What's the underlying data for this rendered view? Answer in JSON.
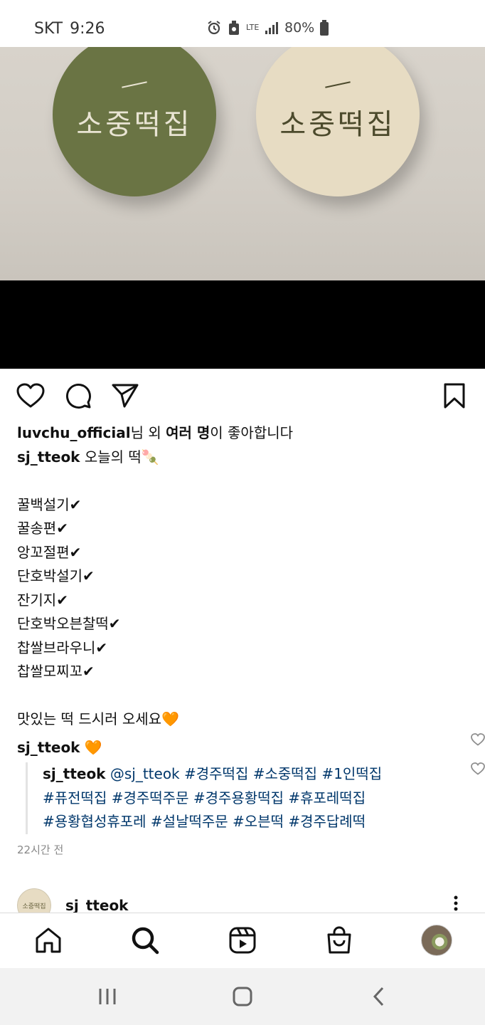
{
  "status_bar": {
    "carrier": "SKT",
    "time": "9:26",
    "network": "LTE",
    "battery": "80%"
  },
  "post_image": {
    "sticker_text": "소중떡집"
  },
  "post": {
    "likes": {
      "liker": "luvchu_official",
      "text_mid": "님 외 ",
      "bold_others": "여러 명",
      "text_end": "이 좋아합니다"
    },
    "caption_user": "sj_tteok",
    "caption_first": "오늘의 떡🍡",
    "caption_lines": [
      "꿀백설기✔",
      "꿀송편✔",
      "앙꼬절편✔",
      "단호박설기✔",
      "잔기지✔",
      "단호박오븐찰떡✔",
      "찹쌀브라우니✔",
      "찹쌀모찌꼬✔"
    ],
    "caption_closing": "맛있는 떡 드시러 오세요🧡",
    "comment": {
      "user": "sj_tteok",
      "text": "🧡"
    },
    "reply": {
      "user": "sj_tteok",
      "line1": "@sj_tteok #경주떡집 #소중떡집 #1인떡집",
      "line2": "#퓨전떡집 #경주떡주문 #경주용황떡집 #휴포레떡집",
      "line3": "#용황협성휴포레 #설날떡주문 #오븐떡 #경주답례떡"
    },
    "timestamp": "22시간 전"
  },
  "next_post": {
    "avatar_text": "소중떡집",
    "user": "sj_tteok"
  },
  "icons": {
    "like": "heart-icon",
    "comment": "comment-icon",
    "share": "send-icon",
    "save": "bookmark-icon",
    "home": "home-icon",
    "search": "search-icon",
    "reels": "reels-icon",
    "shop": "shop-icon"
  }
}
